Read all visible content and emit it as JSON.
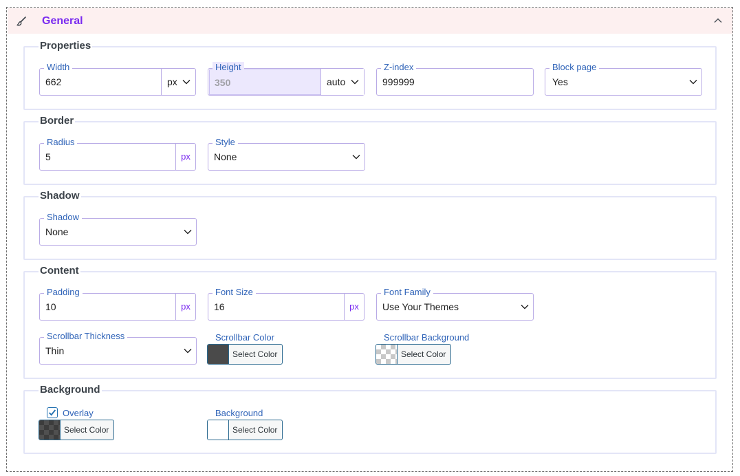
{
  "panel": {
    "title": "General",
    "icons": {
      "edit": "paintbrush-icon",
      "collapse": "chevron-up-icon"
    }
  },
  "colors": {
    "accent": "#7a2bf0",
    "label": "#2f63b8",
    "header_bg": "#fdf0f0",
    "border": "#b9abe6"
  },
  "properties": {
    "legend": "Properties",
    "width": {
      "label": "Width",
      "value": "662",
      "unit": "px"
    },
    "height": {
      "label": "Height",
      "value": "350",
      "unit": "auto"
    },
    "zindex": {
      "label": "Z-index",
      "value": "999999"
    },
    "block_page": {
      "label": "Block page",
      "value": "Yes"
    }
  },
  "border": {
    "legend": "Border",
    "radius": {
      "label": "Radius",
      "value": "5",
      "unit": "px"
    },
    "style": {
      "label": "Style",
      "value": "None"
    }
  },
  "shadow": {
    "legend": "Shadow",
    "shadow": {
      "label": "Shadow",
      "value": "None"
    }
  },
  "content": {
    "legend": "Content",
    "padding": {
      "label": "Padding",
      "value": "10",
      "unit": "px"
    },
    "font_size": {
      "label": "Font Size",
      "value": "16",
      "unit": "px"
    },
    "font_family": {
      "label": "Font Family",
      "value": "Use Your Themes"
    },
    "scrollbar_thickness": {
      "label": "Scrollbar Thickness",
      "value": "Thin"
    },
    "scrollbar_color": {
      "label": "Scrollbar Color",
      "button": "Select Color",
      "color": "#4a4a4a"
    },
    "scrollbar_background": {
      "label": "Scrollbar Background",
      "button": "Select Color",
      "color": "transparent"
    }
  },
  "background": {
    "legend": "Background",
    "overlay": {
      "label": "Overlay",
      "checked": true,
      "button": "Select Color",
      "color": "dark-transparent"
    },
    "background": {
      "label": "Background",
      "button": "Select Color",
      "color": "#ffffff"
    }
  }
}
